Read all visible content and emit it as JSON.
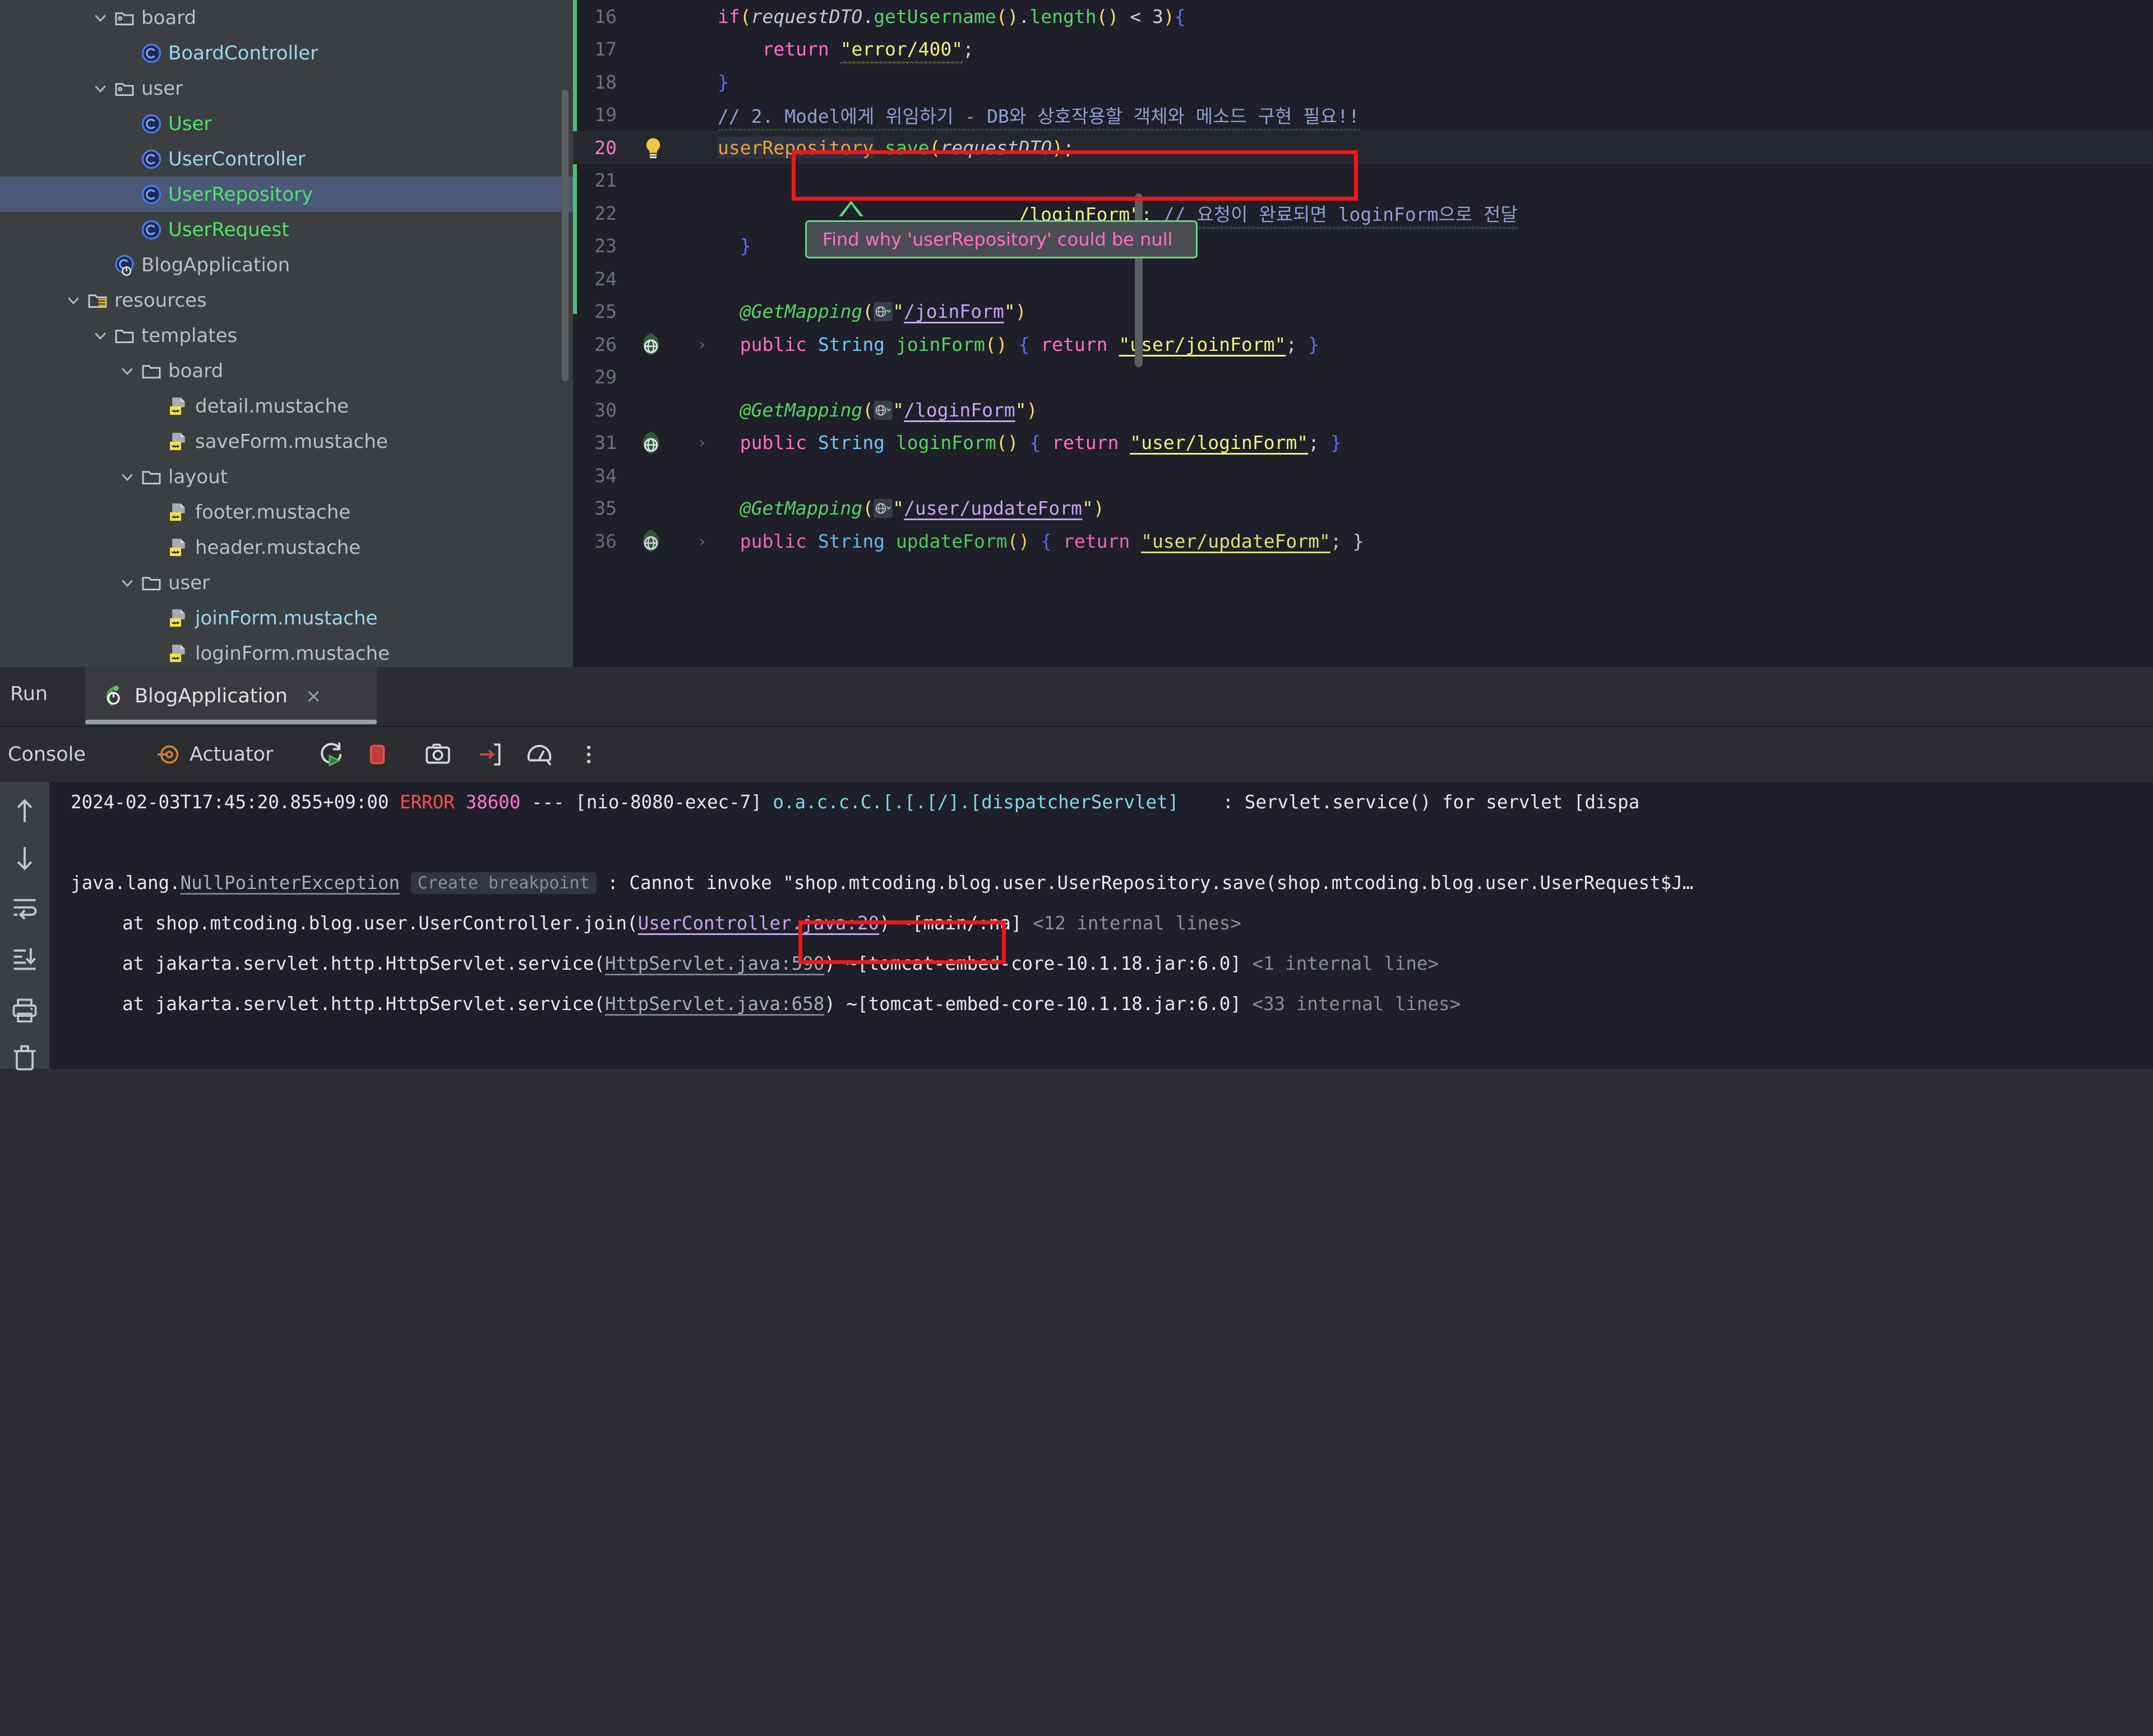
{
  "project_tree": {
    "items": [
      {
        "indent": 3,
        "chevron": "down",
        "icon": "package-icon",
        "label": "board",
        "color": "grey",
        "selected": false
      },
      {
        "indent": 4,
        "chevron": "none",
        "icon": "class-icon",
        "label": "BoardController",
        "color": "cyan",
        "selected": false
      },
      {
        "indent": 3,
        "chevron": "down",
        "icon": "package-icon",
        "label": "user",
        "color": "grey",
        "selected": false
      },
      {
        "indent": 4,
        "chevron": "none",
        "icon": "class-icon",
        "label": "User",
        "color": "green",
        "selected": false
      },
      {
        "indent": 4,
        "chevron": "none",
        "icon": "class-icon",
        "label": "UserController",
        "color": "cyan",
        "selected": false
      },
      {
        "indent": 4,
        "chevron": "none",
        "icon": "class-icon",
        "label": "UserRepository",
        "color": "green",
        "selected": true
      },
      {
        "indent": 4,
        "chevron": "none",
        "icon": "class-icon",
        "label": "UserRequest",
        "color": "green",
        "selected": false
      },
      {
        "indent": 3,
        "chevron": "none",
        "icon": "spring-class-icon",
        "label": "BlogApplication",
        "color": "grey",
        "selected": false
      },
      {
        "indent": 2,
        "chevron": "down",
        "icon": "resources-folder-icon",
        "label": "resources",
        "color": "grey",
        "selected": false
      },
      {
        "indent": 3,
        "chevron": "down",
        "icon": "folder-icon",
        "label": "templates",
        "color": "grey",
        "selected": false
      },
      {
        "indent": 4,
        "chevron": "down",
        "icon": "folder-icon",
        "label": "board",
        "color": "grey",
        "selected": false
      },
      {
        "indent": 5,
        "chevron": "none",
        "icon": "mustache-file-icon",
        "label": "detail.mustache",
        "color": "grey",
        "selected": false
      },
      {
        "indent": 5,
        "chevron": "none",
        "icon": "mustache-file-icon",
        "label": "saveForm.mustache",
        "color": "grey",
        "selected": false
      },
      {
        "indent": 4,
        "chevron": "down",
        "icon": "folder-icon",
        "label": "layout",
        "color": "grey",
        "selected": false
      },
      {
        "indent": 5,
        "chevron": "none",
        "icon": "mustache-file-icon",
        "label": "footer.mustache",
        "color": "grey",
        "selected": false
      },
      {
        "indent": 5,
        "chevron": "none",
        "icon": "mustache-file-icon",
        "label": "header.mustache",
        "color": "grey",
        "selected": false
      },
      {
        "indent": 4,
        "chevron": "down",
        "icon": "folder-icon",
        "label": "user",
        "color": "grey",
        "selected": false
      },
      {
        "indent": 5,
        "chevron": "none",
        "icon": "mustache-file-icon",
        "label": "joinForm.mustache",
        "color": "cyan",
        "selected": false
      },
      {
        "indent": 5,
        "chevron": "none",
        "icon": "mustache-file-icon",
        "label": "loginForm.mustache",
        "color": "grey",
        "selected": false
      }
    ]
  },
  "editor": {
    "lines": [
      {
        "num": "16",
        "gutter": "none"
      },
      {
        "num": "17",
        "gutter": "none"
      },
      {
        "num": "18",
        "gutter": "none"
      },
      {
        "num": "19",
        "gutter": "none"
      },
      {
        "num": "20",
        "gutter": "bulb-icon",
        "current": true
      },
      {
        "num": "21",
        "gutter": "none"
      },
      {
        "num": "22",
        "gutter": "none"
      },
      {
        "num": "23",
        "gutter": "none"
      },
      {
        "num": "24",
        "gutter": "none"
      },
      {
        "num": "25",
        "gutter": "none"
      },
      {
        "num": "26",
        "gutter": "globe-icon",
        "fold": "›"
      },
      {
        "num": "29",
        "gutter": "none"
      },
      {
        "num": "30",
        "gutter": "none"
      },
      {
        "num": "31",
        "gutter": "globe-icon",
        "fold": "›"
      },
      {
        "num": "34",
        "gutter": "none"
      },
      {
        "num": "35",
        "gutter": "none"
      },
      {
        "num": "36",
        "gutter": "globe-icon",
        "fold": "›"
      }
    ],
    "code": {
      "l16_if": "if",
      "l16_open": "(",
      "l16_var": "requestDTO",
      "l16_dot1": ".",
      "l16_m1": "getUsername",
      "l16_p1": "()",
      "l16_dot2": ".",
      "l16_m2": "length",
      "l16_p2": "()",
      "l16_cmp": " < ",
      "l16_n": "3",
      "l16_close": ")",
      "l16_brace": "{",
      "l17_return": "return",
      "l17_str": "\"error/400\"",
      "l17_semi": ";",
      "l18_brace": "}",
      "l19_comment": "// 2. Model에게 위임하기 - DB와 상호작용할 객체와 메소드 구현 필요!!",
      "l20_var": "userRepository",
      "l20_dot": ".",
      "l20_m": "save",
      "l20_open": "(",
      "l20_arg": "requestDTO",
      "l20_close": ")",
      "l20_semi": ";",
      "l22_str": "/loginForm\"",
      "l22_semi": "; ",
      "l22_comment": "// 요청이 완료되면 loginForm으로 전달",
      "l23_brace": "}",
      "l25_anno": "@GetMapping",
      "l25_open": "(",
      "l25_str_q1": "\"",
      "l25_path": "/joinForm",
      "l25_str_q2": "\"",
      "l25_close": ")",
      "l26_public": "public",
      "l26_type": "String",
      "l26_name": "joinForm",
      "l26_parens": "()",
      "l26_obrace": " { ",
      "l26_return": "return",
      "l26_str": "\"user/joinForm\"",
      "l26_semi": "; ",
      "l26_cbrace": "}",
      "l30_anno": "@GetMapping",
      "l30_path": "/loginForm",
      "l31_name": "loginForm",
      "l31_str": "\"user/loginForm\"",
      "l35_anno": "@GetMapping",
      "l35_path": "/user/updateForm",
      "l36_name": "updateForm",
      "l36_str": "\"user/updateForm\""
    },
    "tooltip": {
      "text": "Find why 'userRepository' could be null"
    }
  },
  "run_panel": {
    "title": "Run",
    "tab": {
      "label": "BlogApplication",
      "close": "×",
      "icon": "spring-boot-icon"
    },
    "toolbar": {
      "console_label": "Console",
      "actuator_label": "Actuator",
      "rerun_icon": "rerun-icon",
      "stop_icon": "stop-icon",
      "camera_icon": "camera-icon",
      "dump_icon": "thread-dump-icon",
      "profiler_icon": "profiler-icon",
      "more_icon": "more-vertical-icon"
    },
    "gutter_icons": [
      "scroll-up-icon",
      "scroll-down-icon",
      "soft-wrap-icon",
      "scroll-to-end-icon",
      "print-icon",
      "clear-all-icon"
    ]
  },
  "console": {
    "log1": {
      "timestamp": "2024-02-03T17:45:20.855+09:00",
      "level": "ERROR",
      "pid": "38600",
      "dashes": "---",
      "thread": "[nio-8080-exec-7]",
      "logger": "o.a.c.c.C.[.[.[/].[dispatcherServlet]",
      "sep": ":",
      "message": "Servlet.service() for servlet [dispa"
    },
    "log2": {
      "prefix": "java.lang.",
      "exception": "NullPointerException",
      "breakpoint_chip": "Create breakpoint",
      "sep": ":",
      "message": "Cannot invoke \"shop.mtcoding.blog.user.UserRepository.save(shop.mtcoding.blog.user.UserRequest$J…"
    },
    "stack": [
      {
        "arrow": "›",
        "at": "at shop.mtcoding.blog.user.UserController.join",
        "open": "(",
        "link": "UserController.java:20",
        "close": ")",
        "jar": " ~[main/:na] ",
        "internal": "<12 internal lines>",
        "link_color": "purple"
      },
      {
        "arrow": "›",
        "at": "at jakarta.servlet.http.HttpServlet.service",
        "open": "(",
        "link": "HttpServlet.java:590",
        "close": ")",
        "jar": " ~[tomcat-embed-core-10.1.18.jar:6.0] ",
        "internal": "<1 internal line>",
        "link_color": "grey"
      },
      {
        "arrow": "›",
        "at": "at jakarta.servlet.http.HttpServlet.service",
        "open": "(",
        "link": "HttpServlet.java:658",
        "close": ")",
        "jar": " ~[tomcat-embed-core-10.1.18.jar:6.0] ",
        "internal": "<33 internal lines>",
        "link_color": "grey"
      }
    ]
  },
  "annotations": {
    "redbox_code_label": "red-highlight-code-line-20",
    "redbox_stack_label": "red-highlight-usercontroller-link"
  },
  "colors": {
    "accent": "#4a88e0",
    "error": "#ff4d4d",
    "highlight": "#f01717",
    "selection": "#4b5878",
    "tooltip_border": "#5dd97f"
  }
}
